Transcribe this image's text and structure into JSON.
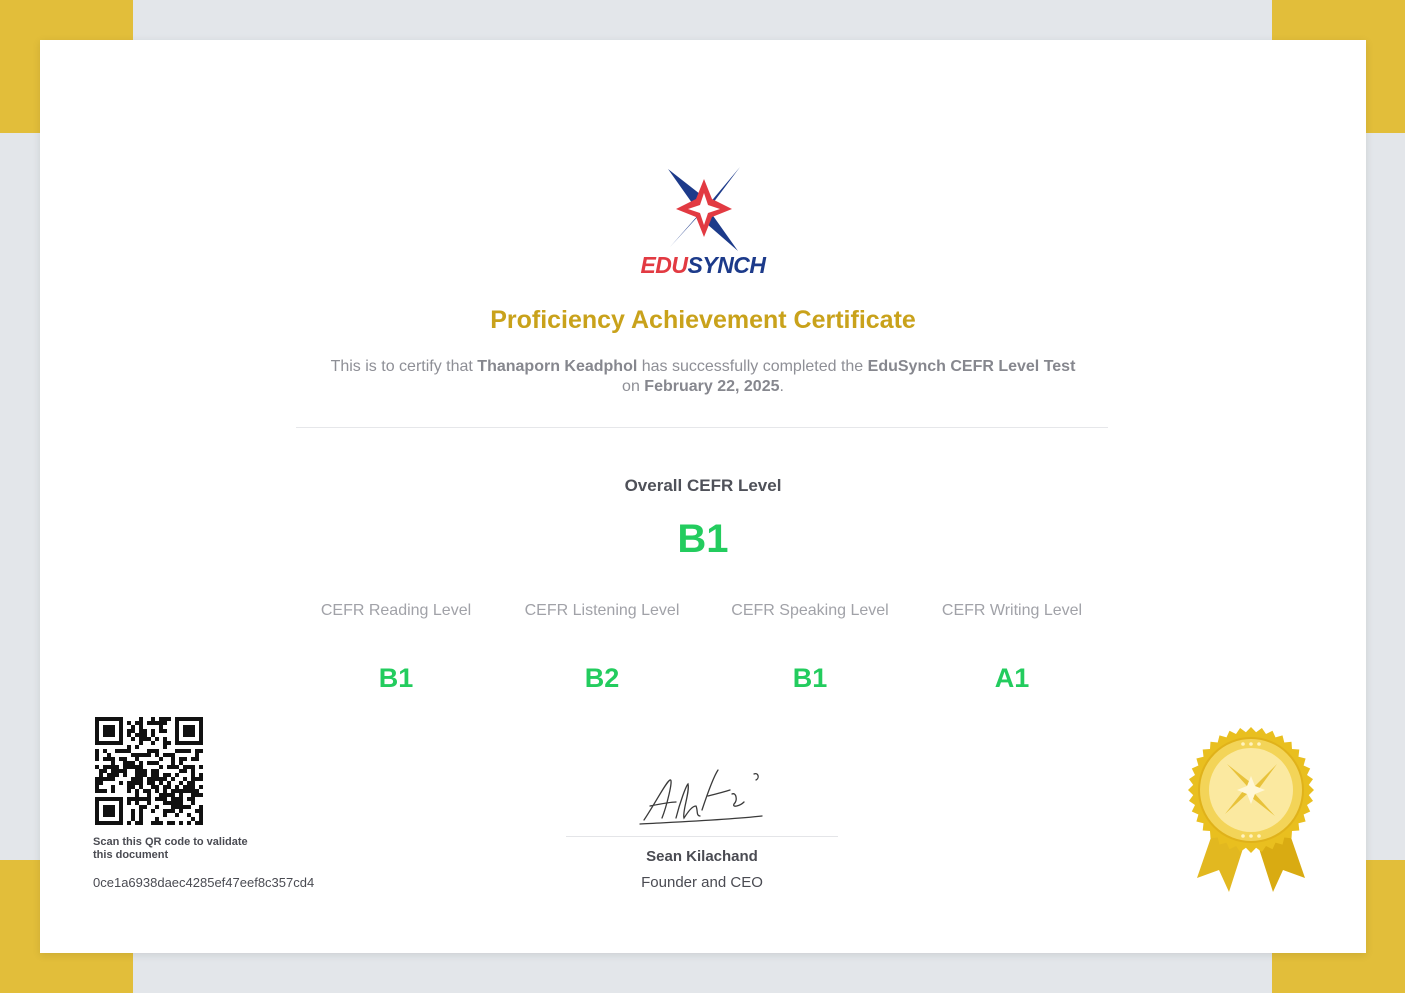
{
  "colors": {
    "gold": "#c9a21b",
    "accent_green": "#23cc5e",
    "frame_corner": "#e2be3a",
    "brand_red": "#e23a42",
    "brand_blue": "#1c3a8a"
  },
  "brand": {
    "part1": "EDU",
    "part2": "SYNCH",
    "logo_icon": "star-compass-logo"
  },
  "certificate": {
    "title": "Proficiency Achievement Certificate",
    "intro": "This is to certify that",
    "recipient": "Thanaporn Keadphol",
    "middle": "has successfully completed the",
    "test_name": "EduSynch CEFR Level Test",
    "date_prefix": "on",
    "date": "February 22, 2025",
    "date_suffix": "."
  },
  "overall": {
    "label": "Overall CEFR Level",
    "value": "B1"
  },
  "skills": [
    {
      "label": "CEFR Reading Level",
      "value": "B1"
    },
    {
      "label": "CEFR Listening Level",
      "value": "B2"
    },
    {
      "label": "CEFR Speaking Level",
      "value": "B1"
    },
    {
      "label": "CEFR Writing Level",
      "value": "A1"
    }
  ],
  "verification": {
    "qr_caption": "Scan this QR code to validate this document",
    "hash": "0ce1a6938daec4285ef47eef8c357cd4"
  },
  "signatory": {
    "name": "Sean Kilachand",
    "title": "Founder and CEO"
  },
  "seal": {
    "icon": "gold-award-seal-icon"
  }
}
